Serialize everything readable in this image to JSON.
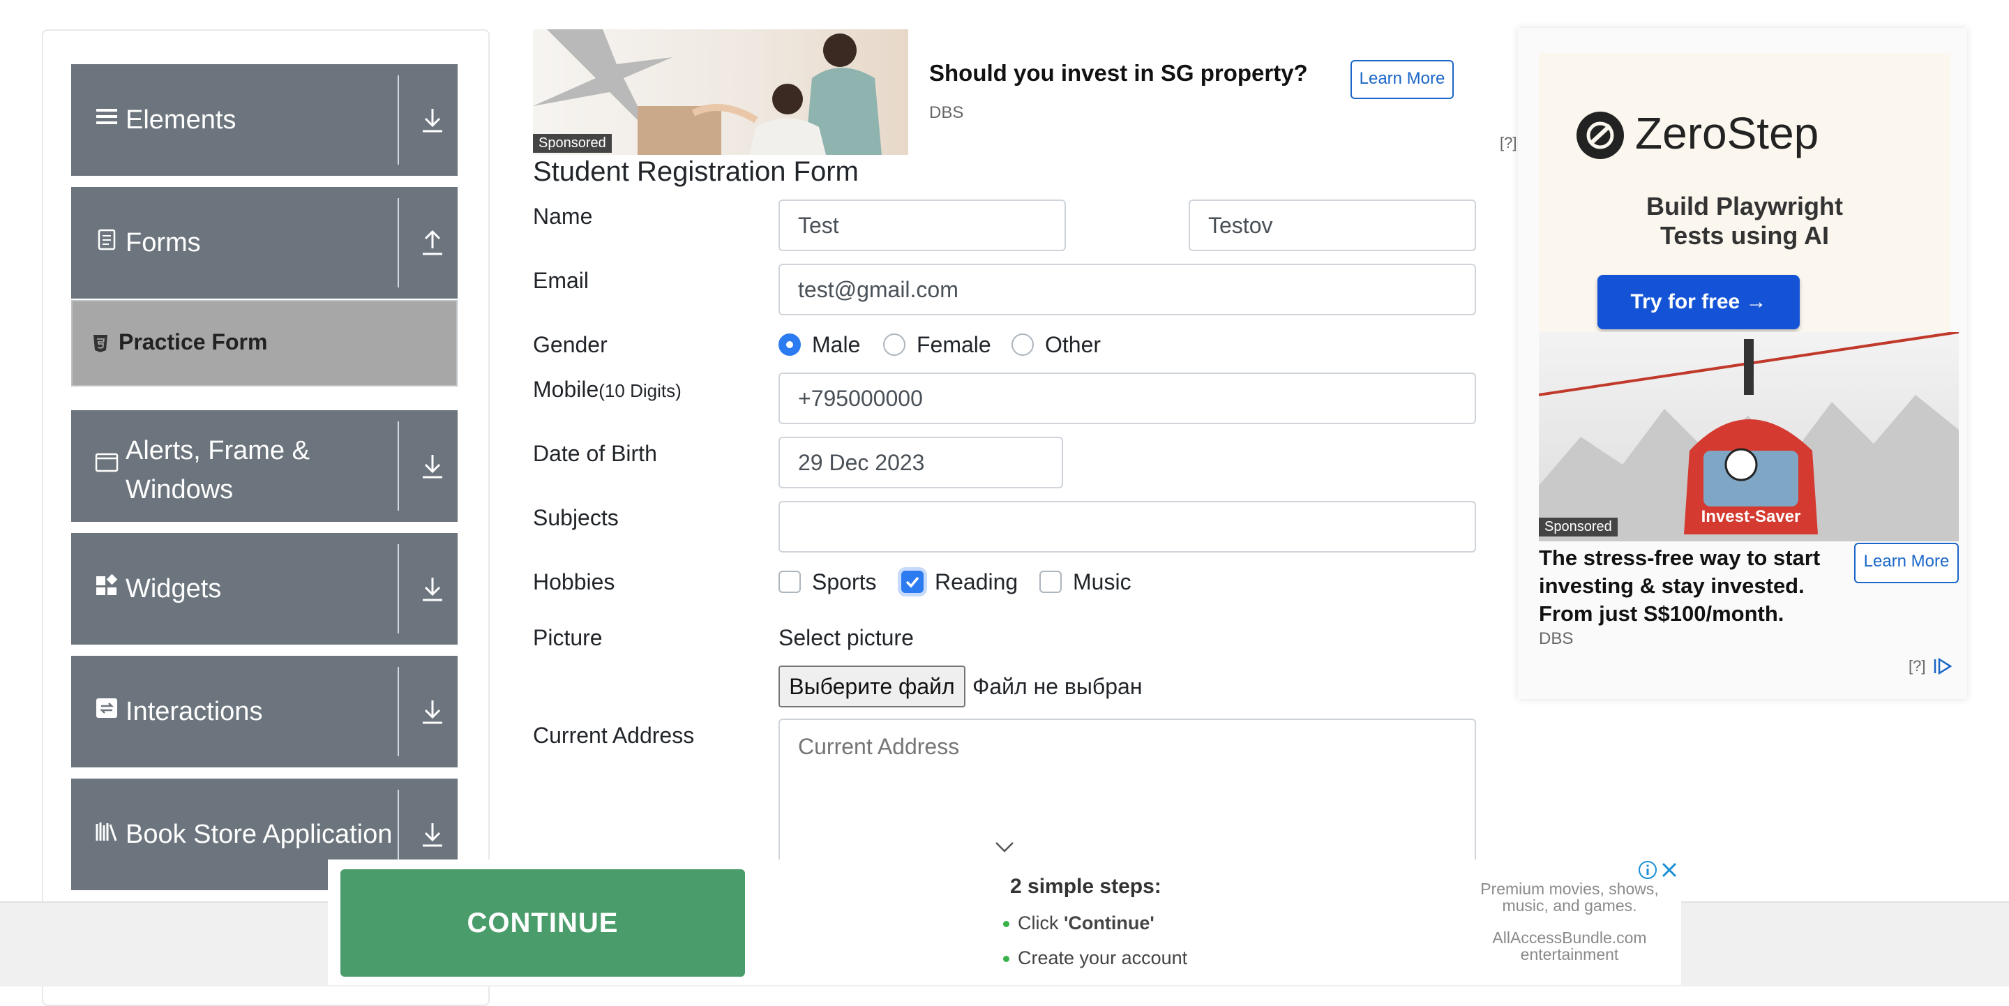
{
  "sidebar": {
    "groups": [
      {
        "label": "Elements",
        "icon": "list-icon",
        "arrow": "download-icon"
      },
      {
        "label": "Forms",
        "icon": "document-icon",
        "arrow": "upload-icon"
      },
      {
        "label_line1": "Alerts, Frame &",
        "label_line2": "Windows",
        "icon": "window-icon",
        "arrow": "download-icon"
      },
      {
        "label": "Widgets",
        "icon": "widgets-icon",
        "arrow": "download-icon"
      },
      {
        "label": "Interactions",
        "icon": "interactions-icon",
        "arrow": "download-icon"
      },
      {
        "label": "Book Store Application",
        "icon": "books-icon",
        "arrow": "download-icon"
      }
    ],
    "active_item": "Practice Form"
  },
  "top_ad": {
    "sponsored": "Sponsored",
    "headline": "Should you invest in SG property?",
    "brand": "DBS",
    "cta": "Learn More",
    "help": "[?]"
  },
  "form": {
    "title": "Student Registration Form",
    "name_label": "Name",
    "first_name": "Test",
    "last_name": "Testov",
    "email_label": "Email",
    "email": "test@gmail.com",
    "gender_label": "Gender",
    "gender_options": [
      "Male",
      "Female",
      "Other"
    ],
    "gender_selected": "Male",
    "mobile_label": "Mobile",
    "mobile_hint": "(10 Digits)",
    "mobile": "+795000000",
    "dob_label": "Date of Birth",
    "dob": "29 Dec 2023",
    "subjects_label": "Subjects",
    "subjects": "",
    "hobbies_label": "Hobbies",
    "hobbies": [
      "Sports",
      "Reading",
      "Music"
    ],
    "hobbies_checked": [
      "Reading"
    ],
    "picture_label": "Picture",
    "select_picture": "Select picture",
    "file_button": "Выберите файл",
    "file_status": "Файл не выбран",
    "address_label": "Current Address",
    "address_placeholder": "Current Address"
  },
  "right_ad": {
    "brand_name": "ZeroStep",
    "tagline_line1": "Build Playwright",
    "tagline_line2": "Tests using AI",
    "cta": "Try for free →",
    "gondola_label": "Invest-Saver",
    "sponsored": "Sponsored",
    "headline": "The stress-free way to start investing & stay invested. From just S$100/month.",
    "brand": "DBS",
    "learn_more": "Learn More",
    "help": "[?]"
  },
  "bottom_ad": {
    "cta": "CONTINUE",
    "steps_title": "2 simple steps:",
    "step1_prefix": "Click ",
    "step1_bold": "'Continue'",
    "step2": "Create your account",
    "right_line1": "Premium movies, shows,",
    "right_line2": "music, and games.",
    "right_line3": "AllAccessBundle.com",
    "right_line4": "entertainment"
  },
  "colors": {
    "sidebar_group": "#6c757d",
    "active_item": "#a7a7a7",
    "accent": "#2d7bf0",
    "continue": "#4a9d6a",
    "zerostep_cta": "#1553d6"
  }
}
